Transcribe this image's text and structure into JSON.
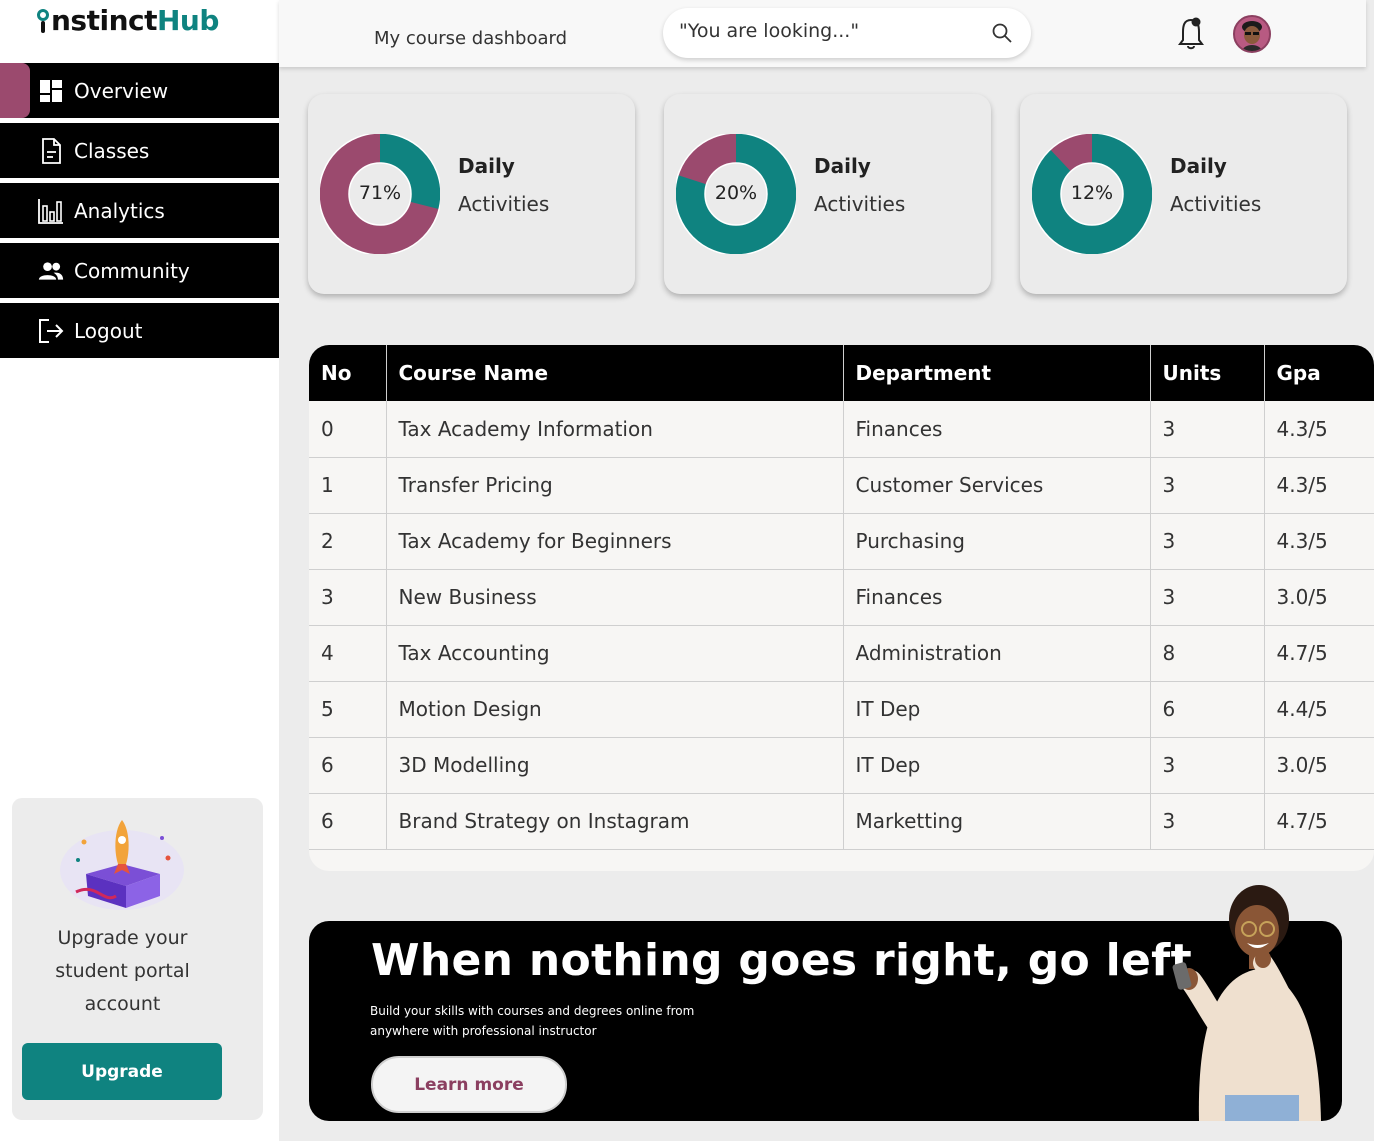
{
  "brand": {
    "logo_text_dark": "nstinct",
    "logo_text_teal": "Hub",
    "accent": "#0f8380",
    "secondary": "#9b4a6e"
  },
  "sidebar": {
    "items": [
      {
        "label": "Overview",
        "icon": "grid-icon",
        "active": true
      },
      {
        "label": "Classes",
        "icon": "document-icon"
      },
      {
        "label": "Analytics",
        "icon": "bar-chart-icon"
      },
      {
        "label": "Community",
        "icon": "people-icon"
      },
      {
        "label": "Logout",
        "icon": "logout-icon"
      }
    ],
    "upgrade": {
      "text_line1": "Upgrade your",
      "text_line2": "student portal",
      "text_line3": "account",
      "button": "Upgrade"
    }
  },
  "header": {
    "title": "My course dashboard",
    "search_placeholder": "\"You are looking...\""
  },
  "stats": [
    {
      "percent": 71,
      "label": "71%",
      "title": "Daily",
      "subtitle": "Activities"
    },
    {
      "percent": 20,
      "label": "20%",
      "title": "Daily",
      "subtitle": "Activities"
    },
    {
      "percent": 12,
      "label": "12%",
      "title": "Daily",
      "subtitle": "Activities"
    }
  ],
  "table": {
    "headers": [
      "No",
      "Course Name",
      "Department",
      "Units",
      "Gpa"
    ],
    "rows": [
      [
        "0",
        "Tax Academy Information",
        "Finances",
        "3",
        "4.3/5"
      ],
      [
        "1",
        "Transfer Pricing",
        "Customer Services",
        "3",
        "4.3/5"
      ],
      [
        "2",
        "Tax Academy for Beginners",
        "Purchasing",
        "3",
        "4.3/5"
      ],
      [
        "3",
        "New Business",
        "Finances",
        "3",
        "3.0/5"
      ],
      [
        "4",
        "Tax Accounting",
        "Administration",
        "8",
        "4.7/5"
      ],
      [
        "5",
        "Motion Design",
        "IT Dep",
        "6",
        "4.4/5"
      ],
      [
        "6",
        "3D Modelling",
        "IT Dep",
        "3",
        "3.0/5"
      ],
      [
        "6",
        "Brand Strategy on Instagram",
        "Marketting",
        "3",
        "4.7/5"
      ]
    ]
  },
  "banner": {
    "title": "When nothing goes right, go left",
    "subtitle": "Build your skills with courses and degrees online from anywhere with professional instructor",
    "button": "Learn more"
  }
}
